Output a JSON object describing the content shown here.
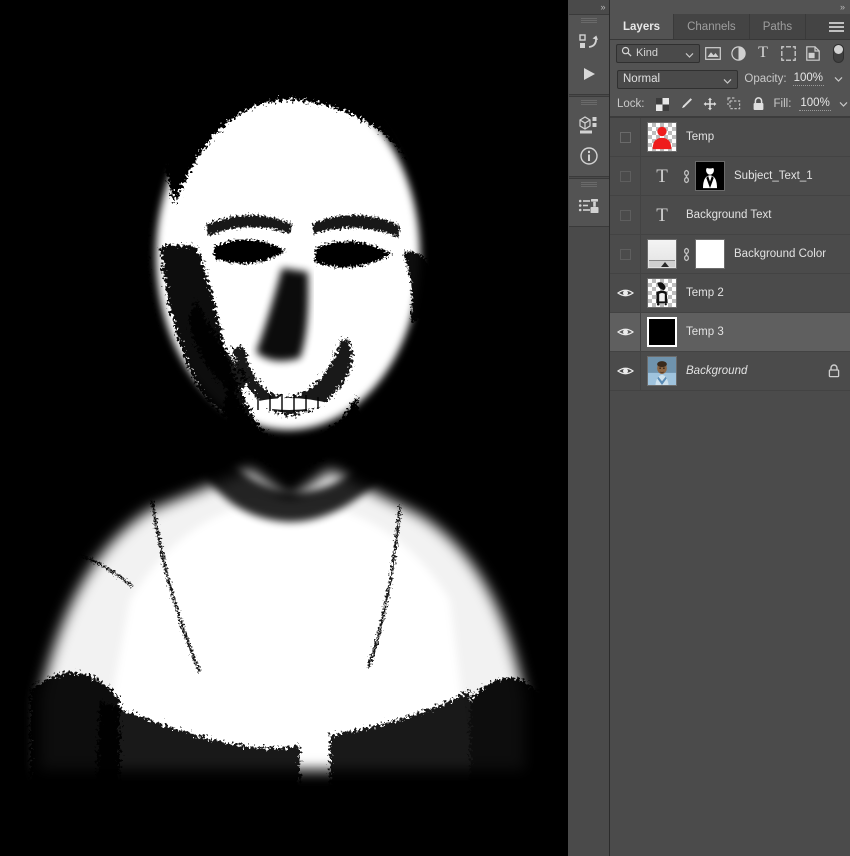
{
  "app": {
    "name": "photoshop-layers-panel"
  },
  "canvas": {
    "description": "high-contrast black-and-white portrait of a man",
    "background_color": "#000000",
    "ink_color": "#ffffff"
  },
  "icon_dock": {
    "collapse_label": "»",
    "groups": [
      {
        "items": [
          {
            "icon": "actions-icon",
            "label": "Actions"
          },
          {
            "icon": "play-icon",
            "label": "Play"
          }
        ]
      },
      {
        "items": [
          {
            "icon": "3d-icon",
            "label": "3D"
          },
          {
            "icon": "info-icon",
            "label": "Info"
          }
        ]
      },
      {
        "items": [
          {
            "icon": "clone-source-icon",
            "label": "Clone Source"
          }
        ]
      }
    ]
  },
  "panel": {
    "collapse_label": "»",
    "menu_icon": "panel-menu-icon",
    "tabs": [
      {
        "label": "Layers",
        "active": true
      },
      {
        "label": "Channels",
        "active": false
      },
      {
        "label": "Paths",
        "active": false
      }
    ],
    "filter": {
      "search_icon": "search-icon",
      "kind_value": "Kind",
      "caret_icon": "chevron-down-icon",
      "type_icons": [
        "pixel-layer-filter-icon",
        "adjustment-layer-filter-icon",
        "type-layer-filter-icon",
        "shape-layer-filter-icon",
        "smart-object-filter-icon"
      ],
      "toggle_icon": "filter-toggle-switch"
    },
    "blend": {
      "mode_value": "Normal",
      "caret_icon": "chevron-down-icon",
      "opacity_label": "Opacity:",
      "opacity_value": "100%"
    },
    "lock": {
      "label": "Lock:",
      "icons": [
        "lock-transparent-pixels-icon",
        "lock-image-pixels-icon",
        "lock-position-icon",
        "lock-artboard-nesting-icon",
        "lock-all-icon"
      ],
      "fill_label": "Fill:",
      "fill_value": "100%"
    },
    "layers": [
      {
        "name": "Temp",
        "visible": false,
        "selected": false,
        "italic": false,
        "locked": false,
        "thumbs": [
          {
            "kind": "red-silhouette",
            "checker": true,
            "selected": false
          }
        ]
      },
      {
        "name": "Subject_Text_1",
        "visible": false,
        "selected": false,
        "italic": false,
        "locked": false,
        "thumbs": [
          {
            "kind": "type",
            "checker": false,
            "selected": false
          },
          {
            "kind": "link",
            "checker": false,
            "selected": false
          },
          {
            "kind": "figure-mask",
            "checker": false,
            "selected": false
          }
        ]
      },
      {
        "name": "Background Text",
        "visible": false,
        "selected": false,
        "italic": false,
        "locked": false,
        "thumbs": [
          {
            "kind": "type",
            "checker": false,
            "selected": false
          }
        ]
      },
      {
        "name": "Background Color",
        "visible": false,
        "selected": false,
        "italic": false,
        "locked": false,
        "thumbs": [
          {
            "kind": "gradient-adjustment",
            "checker": false,
            "selected": false
          },
          {
            "kind": "link",
            "checker": false,
            "selected": false
          },
          {
            "kind": "white-mask",
            "checker": false,
            "selected": false
          }
        ]
      },
      {
        "name": "Temp 2",
        "visible": true,
        "selected": false,
        "italic": false,
        "locked": false,
        "thumbs": [
          {
            "kind": "black-figure",
            "checker": true,
            "selected": false
          }
        ]
      },
      {
        "name": "Temp 3",
        "visible": true,
        "selected": true,
        "italic": false,
        "locked": false,
        "thumbs": [
          {
            "kind": "black-fill",
            "checker": false,
            "selected": true
          }
        ]
      },
      {
        "name": "Background",
        "visible": true,
        "selected": false,
        "italic": true,
        "locked": true,
        "thumbs": [
          {
            "kind": "photo",
            "checker": false,
            "selected": false
          }
        ]
      }
    ]
  },
  "colors": {
    "panel_bg": "#535353",
    "list_bg": "#4b4b4b",
    "row_selected": "#5f5f5f",
    "tab_bg": "#444444",
    "text": "#e2e2e2",
    "text_dim": "#9e9e9e",
    "accent_red": "#ee1c1c"
  }
}
